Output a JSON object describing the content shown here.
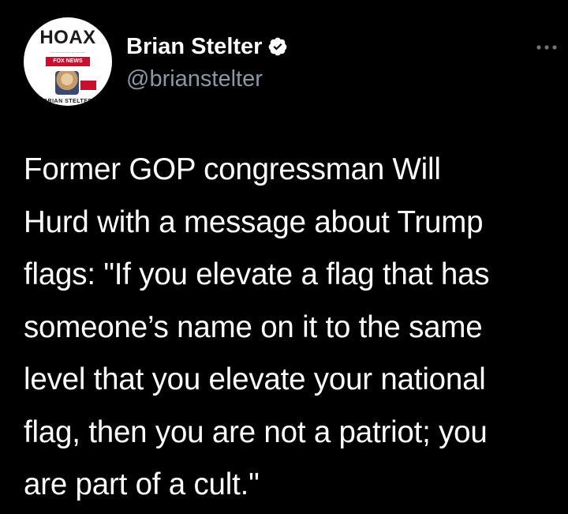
{
  "tweet": {
    "author": {
      "display_name": "Brian Stelter",
      "handle": "@brianstelter",
      "verified": true,
      "avatar": {
        "cover_title": "HOAX",
        "cover_band": "FOX NEWS",
        "cover_author": "BRIAN STELTER"
      }
    },
    "more_icon": "more-horizontal-icon",
    "text": "Former GOP congressman Will\nHurd with a message about Trump\nflags: \"If you elevate a flag that has\nsomeone’s name on it to the same\nlevel that you elevate your national\nflag, then you are not a patriot; you\nare part of a cult.\""
  },
  "colors": {
    "background": "#000000",
    "text": "#ffffff",
    "handle": "#8b98a5",
    "verified_badge": "#ffffff",
    "more_dots": "#6e767d"
  }
}
